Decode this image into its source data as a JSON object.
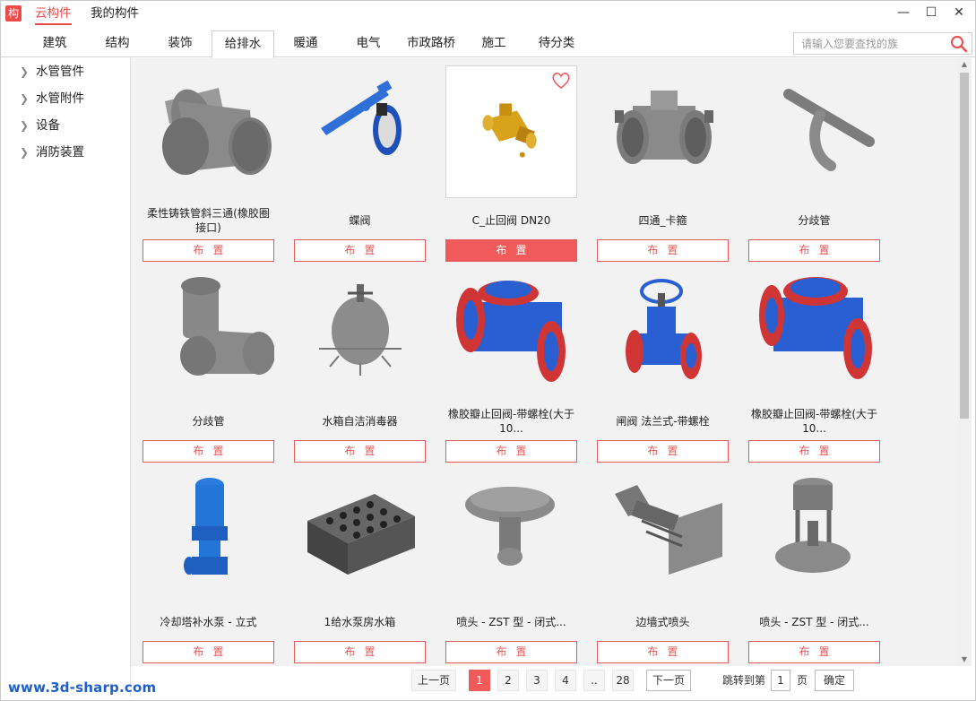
{
  "app": {
    "logo_char": "构",
    "top_tabs": [
      "云构件",
      "我的构件"
    ]
  },
  "window": {
    "minimize": "—",
    "maximize": "☐",
    "close": "✕"
  },
  "categories": [
    "建筑",
    "结构",
    "装饰",
    "给排水",
    "暖通",
    "电气",
    "市政路桥",
    "施工",
    "待分类"
  ],
  "active_category": "给排水",
  "search": {
    "placeholder": "请输入您要查找的族"
  },
  "sidebar": {
    "items": [
      "水管管件",
      "水管附件",
      "设备",
      "消防装置"
    ]
  },
  "place_label": "布置",
  "items": [
    {
      "name": "柔性铸铁管斜三通(橡胶圈接口)",
      "icon": "tee-fitting"
    },
    {
      "name": "蝶阀",
      "icon": "butterfly-valve"
    },
    {
      "name": "C_止回阀 DN20",
      "icon": "check-valve",
      "selected": true
    },
    {
      "name": "四通_卡箍",
      "icon": "cross-clamp"
    },
    {
      "name": "分歧管",
      "icon": "branch-pipe"
    },
    {
      "name": "分歧管",
      "icon": "wye-fitting"
    },
    {
      "name": "水箱自洁消毒器",
      "icon": "tank-sterilizer"
    },
    {
      "name": "橡胶瓣止回阀-带螺栓(大于10...",
      "icon": "flanged-check-valve"
    },
    {
      "name": "闸阀 法兰式-带螺栓",
      "icon": "gate-valve"
    },
    {
      "name": "橡胶瓣止回阀-带螺栓(大于10...",
      "icon": "flanged-check-valve-2"
    },
    {
      "name": "冷却塔补水泵 - 立式",
      "icon": "vertical-pump"
    },
    {
      "name": "1给水泵房水箱",
      "icon": "water-tank"
    },
    {
      "name": "喷头 - ZST 型 - 闭式...",
      "icon": "sprinkler-head"
    },
    {
      "name": "边墙式喷头",
      "icon": "sidewall-sprinkler"
    },
    {
      "name": "喷头 - ZST 型 - 闭式...",
      "icon": "sprinkler-head-2"
    }
  ],
  "pagination": {
    "prev": "上一页",
    "pages": [
      "1",
      "2",
      "3",
      "4",
      "..",
      "28"
    ],
    "current": "1",
    "next": "下一页",
    "jump_label": "跳转到第",
    "jump_value": "1",
    "page_unit": "页",
    "confirm": "确定"
  },
  "watermark": "www.3d-sharp.com",
  "colors": {
    "accent": "#f05a5a",
    "blue": "#1f5fc8",
    "gray_part": "#8c8c8c"
  }
}
